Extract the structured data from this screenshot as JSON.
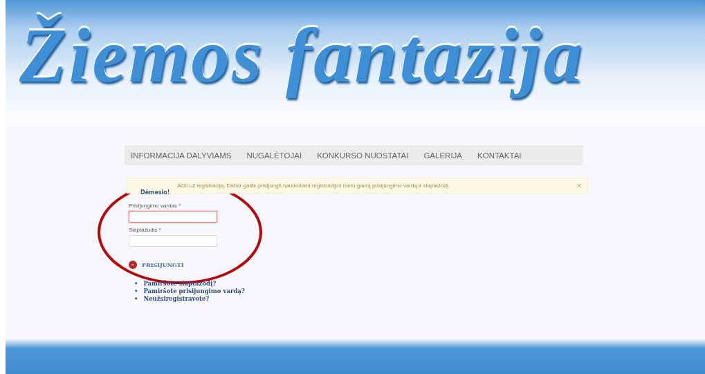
{
  "banner": {
    "title": "Žiemos fantazija"
  },
  "nav": [
    {
      "label": "INFORMACIJA DALYVIAMS"
    },
    {
      "label": "NUGALĖTOJAI"
    },
    {
      "label": "KONKURSO NUOSTATAI"
    },
    {
      "label": "GALERIJA"
    },
    {
      "label": "KONTAKTAI"
    }
  ],
  "alert": {
    "heading": "Dėmesio!",
    "message": "Ačiū už registraciją. Dabar galite prisijungti naudodami registracijos metu gautą prisijungimo vardą ir slaptažodį.",
    "close": "×"
  },
  "form": {
    "fields": [
      {
        "label": "Prisijungimo vardas *",
        "focused": true
      },
      {
        "label": "Slaptažodis *",
        "focused": false
      }
    ],
    "submit": "PRISIJUNGTI"
  },
  "links": [
    {
      "bullet": "•",
      "label": "Pamiršote slaptažodį?"
    },
    {
      "bullet": "•",
      "label": "Pamiršote prisijungimo vardą?"
    },
    {
      "bullet": "•",
      "label": "Neužsiregistravote?"
    }
  ]
}
